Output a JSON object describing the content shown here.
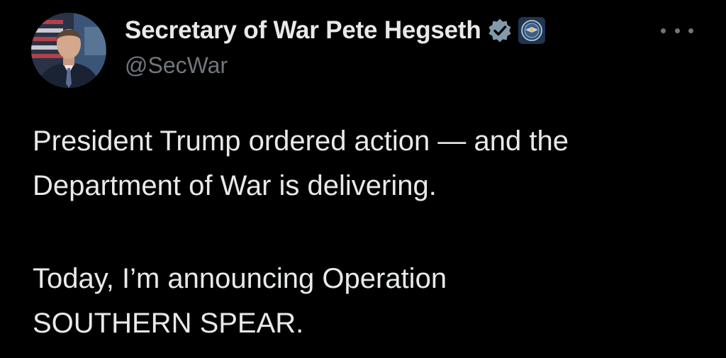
{
  "author": {
    "display_name": "Secretary of War Pete Hegseth",
    "handle": "@SecWar",
    "avatar_icon": "profile-photo-icon",
    "verified_icon": "verified-badge-icon",
    "affiliation_icon": "department-seal-icon"
  },
  "actions": {
    "more_icon": "more-options-icon"
  },
  "tweet": {
    "lines": [
      "President Trump ordered action — and the",
      "Department of War is delivering.",
      "Today, I’m announcing Operation",
      "SOUTHERN SPEAR."
    ]
  },
  "colors": {
    "background": "#000000",
    "primary_text": "#e7e9ea",
    "secondary_text": "#71767b",
    "verified_badge": "#829aab"
  }
}
